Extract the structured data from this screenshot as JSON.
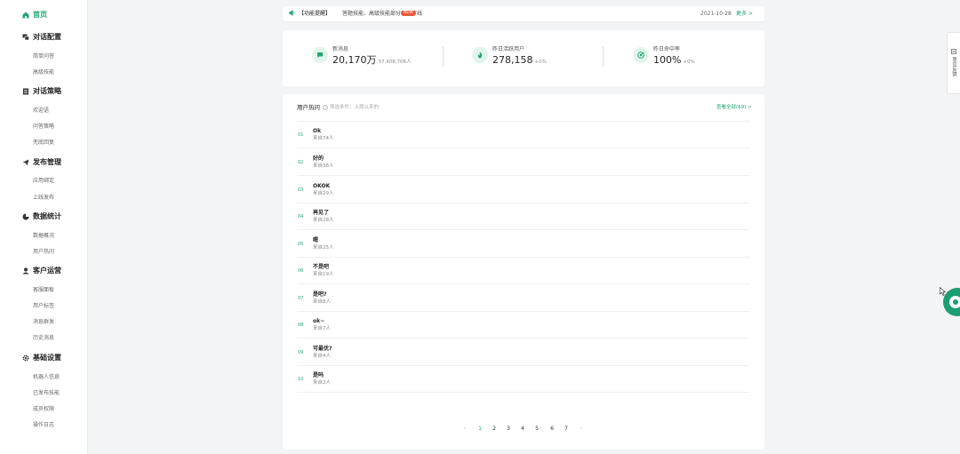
{
  "sidebar": {
    "groups": [
      {
        "label": "首页",
        "icon": "home-icon",
        "items": []
      },
      {
        "label": "对话配置",
        "icon": "chat-config-icon",
        "items": [
          "简单问答",
          "高级技能"
        ]
      },
      {
        "label": "对话策略",
        "icon": "strategy-icon",
        "items": [
          "欢迎语",
          "问答策略",
          "兜底回复"
        ]
      },
      {
        "label": "发布管理",
        "icon": "send-icon",
        "items": [
          "应用绑定",
          "上线发布"
        ]
      },
      {
        "label": "数据统计",
        "icon": "pie-chart-icon",
        "items": [
          "数据概况",
          "用户热问"
        ]
      },
      {
        "label": "客户运营",
        "icon": "user-icon",
        "items": [
          "客服面板",
          "用户标签",
          "消息群发",
          "历史消息"
        ]
      },
      {
        "label": "基础设置",
        "icon": "gear-icon",
        "items": [
          "机器人信息",
          "已发布技能",
          "成员权限",
          "操作日志"
        ]
      }
    ]
  },
  "announcement": {
    "tag": "【功能提醒】",
    "text": "答题技能、高级技能部分功能下线",
    "badge": "NEW",
    "date": "2021-10-28",
    "more": "更多 >"
  },
  "stats": [
    {
      "label": "新消息",
      "value": "20,170万",
      "sub": "37,408,706人",
      "icon": "message-icon"
    },
    {
      "label": "昨日活跃用户",
      "value": "278,158",
      "sub": "+0%",
      "icon": "fire-icon"
    },
    {
      "label": "昨日命中率",
      "value": "100%",
      "sub": "+0%",
      "icon": "target-icon"
    }
  ],
  "hot": {
    "title": "用户热问",
    "subtitle": "筛选条件：上周以来的",
    "view_all": "查看全部(69) >",
    "rows": [
      {
        "num": "01",
        "q": "Ok",
        "c": "来自74人"
      },
      {
        "num": "02",
        "q": "好的",
        "c": "来自38人"
      },
      {
        "num": "03",
        "q": "OKOK",
        "c": "来自29人"
      },
      {
        "num": "04",
        "q": "再见了",
        "c": "来自28人"
      },
      {
        "num": "05",
        "q": "嗯",
        "c": "来自25人"
      },
      {
        "num": "06",
        "q": "不是吧",
        "c": "来自19人"
      },
      {
        "num": "07",
        "q": "是吧?",
        "c": "来自8人"
      },
      {
        "num": "08",
        "q": "ok~",
        "c": "来自7人"
      },
      {
        "num": "09",
        "q": "可最优?",
        "c": "来自4人"
      },
      {
        "num": "10",
        "q": "是吗",
        "c": "来自2人"
      }
    ]
  },
  "pagination": {
    "prev": "‹",
    "pages": [
      "1",
      "2",
      "3",
      "4",
      "5",
      "6",
      "7"
    ],
    "next": "›",
    "active": "1"
  },
  "side_tab": {
    "label": "意见反馈"
  },
  "colors": {
    "accent": "#1fa672",
    "badge": "#e85a3c"
  }
}
